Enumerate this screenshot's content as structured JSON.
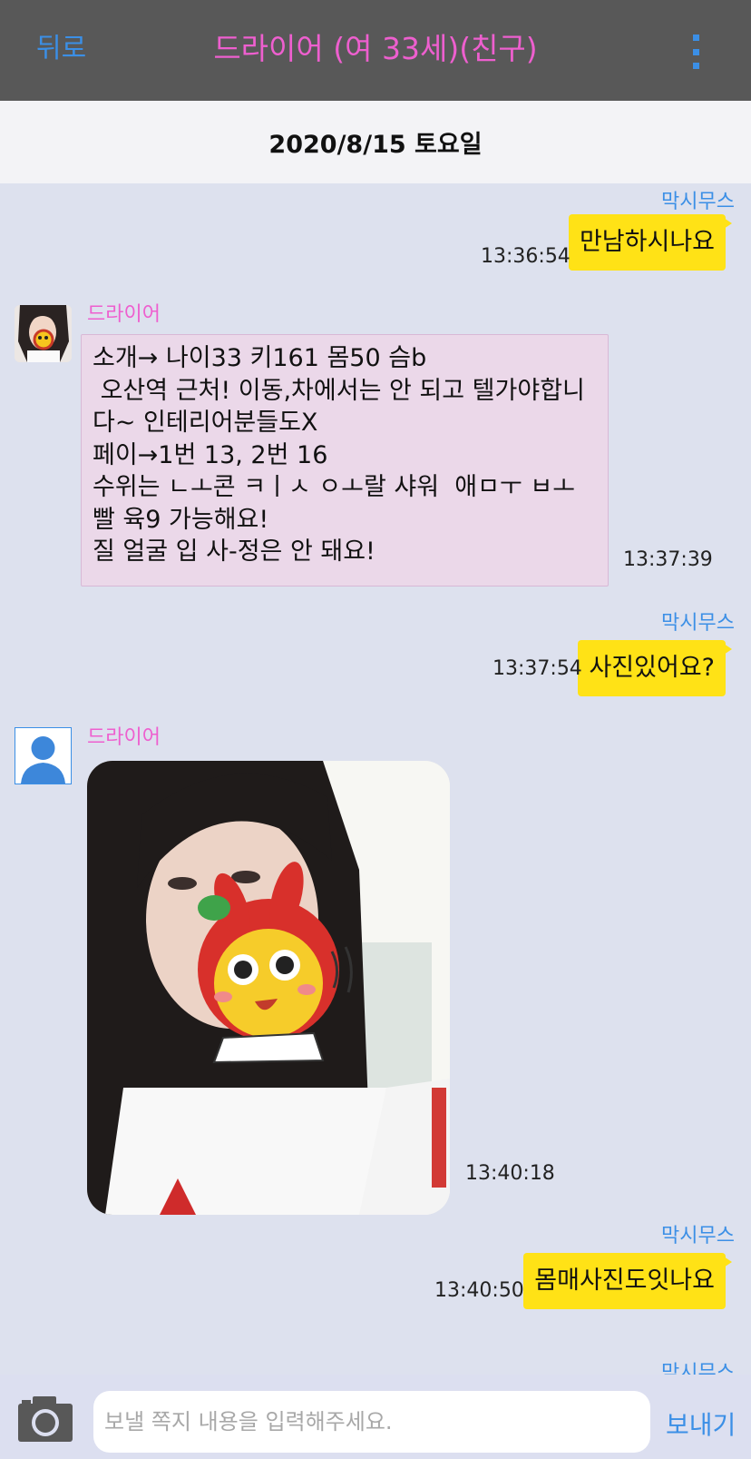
{
  "header": {
    "back_label": "뒤로",
    "title": "드라이어 (여 33세)(친구)",
    "menu_icon": "more-vertical-icon",
    "accent_color": "#3b8fe6",
    "title_color": "#ee5fcf"
  },
  "date_label": "2020/8/15 토요일",
  "messages": [
    {
      "from": "me",
      "sender": "막시무스",
      "text": "만남하시나요",
      "time": "13:36:54"
    },
    {
      "from": "them",
      "sender": "드라이어",
      "text": "소개→ 나이33 키161 몸50 슴b\n 오산역 근처! 이동,차에서는 안 되고 텔가야합니다~ 인테리어분들도X\n페이→1번 13, 2번 16\n수위는 ㄴㅗ콘 ㅋㅣㅅ ㅇㅗ랄 샤워  애ㅁㅜ ㅂㅗ빨 육9 가능해요!\n질 얼굴 입 사-정은 안 돼요!",
      "time": "13:37:39"
    },
    {
      "from": "me",
      "sender": "막시무스",
      "text": "사진있어요?",
      "time": "13:37:54"
    },
    {
      "from": "them",
      "sender": "드라이어",
      "type": "photo",
      "time": "13:40:18"
    },
    {
      "from": "me",
      "sender": "막시무스",
      "text": "몸매사진도잇나요",
      "time": "13:40:50"
    },
    {
      "from": "me",
      "sender": "막시무스"
    }
  ],
  "composer": {
    "camera_icon": "camera-icon",
    "placeholder": "보낼 쪽지 내용을 입력해주세요.",
    "send_label": "보내기"
  }
}
